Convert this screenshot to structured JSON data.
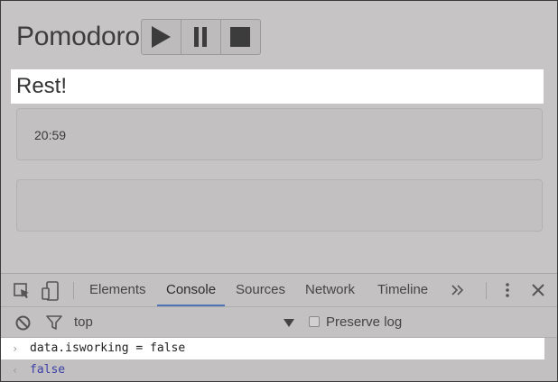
{
  "app": {
    "title": "Pomodoro",
    "controls": [
      {
        "name": "play-button",
        "icon": "play-icon"
      },
      {
        "name": "pause-button",
        "icon": "pause-icon"
      },
      {
        "name": "stop-button",
        "icon": "stop-icon"
      }
    ],
    "status": "Rest!",
    "timer": "20:59"
  },
  "devtools": {
    "tabs": [
      "Elements",
      "Console",
      "Sources",
      "Network",
      "Timeline"
    ],
    "active_tab": "Console",
    "overflow_icon": "double-chevron-right-icon",
    "filter": {
      "context": "top",
      "preserve_log_label": "Preserve log",
      "preserve_log_checked": false
    },
    "console": {
      "input_prompt": "›",
      "input": "data.isworking = false",
      "output_prompt": "‹",
      "output": "false"
    }
  },
  "colors": {
    "background": "#c6c4c4",
    "active_tab_underline": "#4f73b5",
    "console_output": "#3b3fa8"
  }
}
